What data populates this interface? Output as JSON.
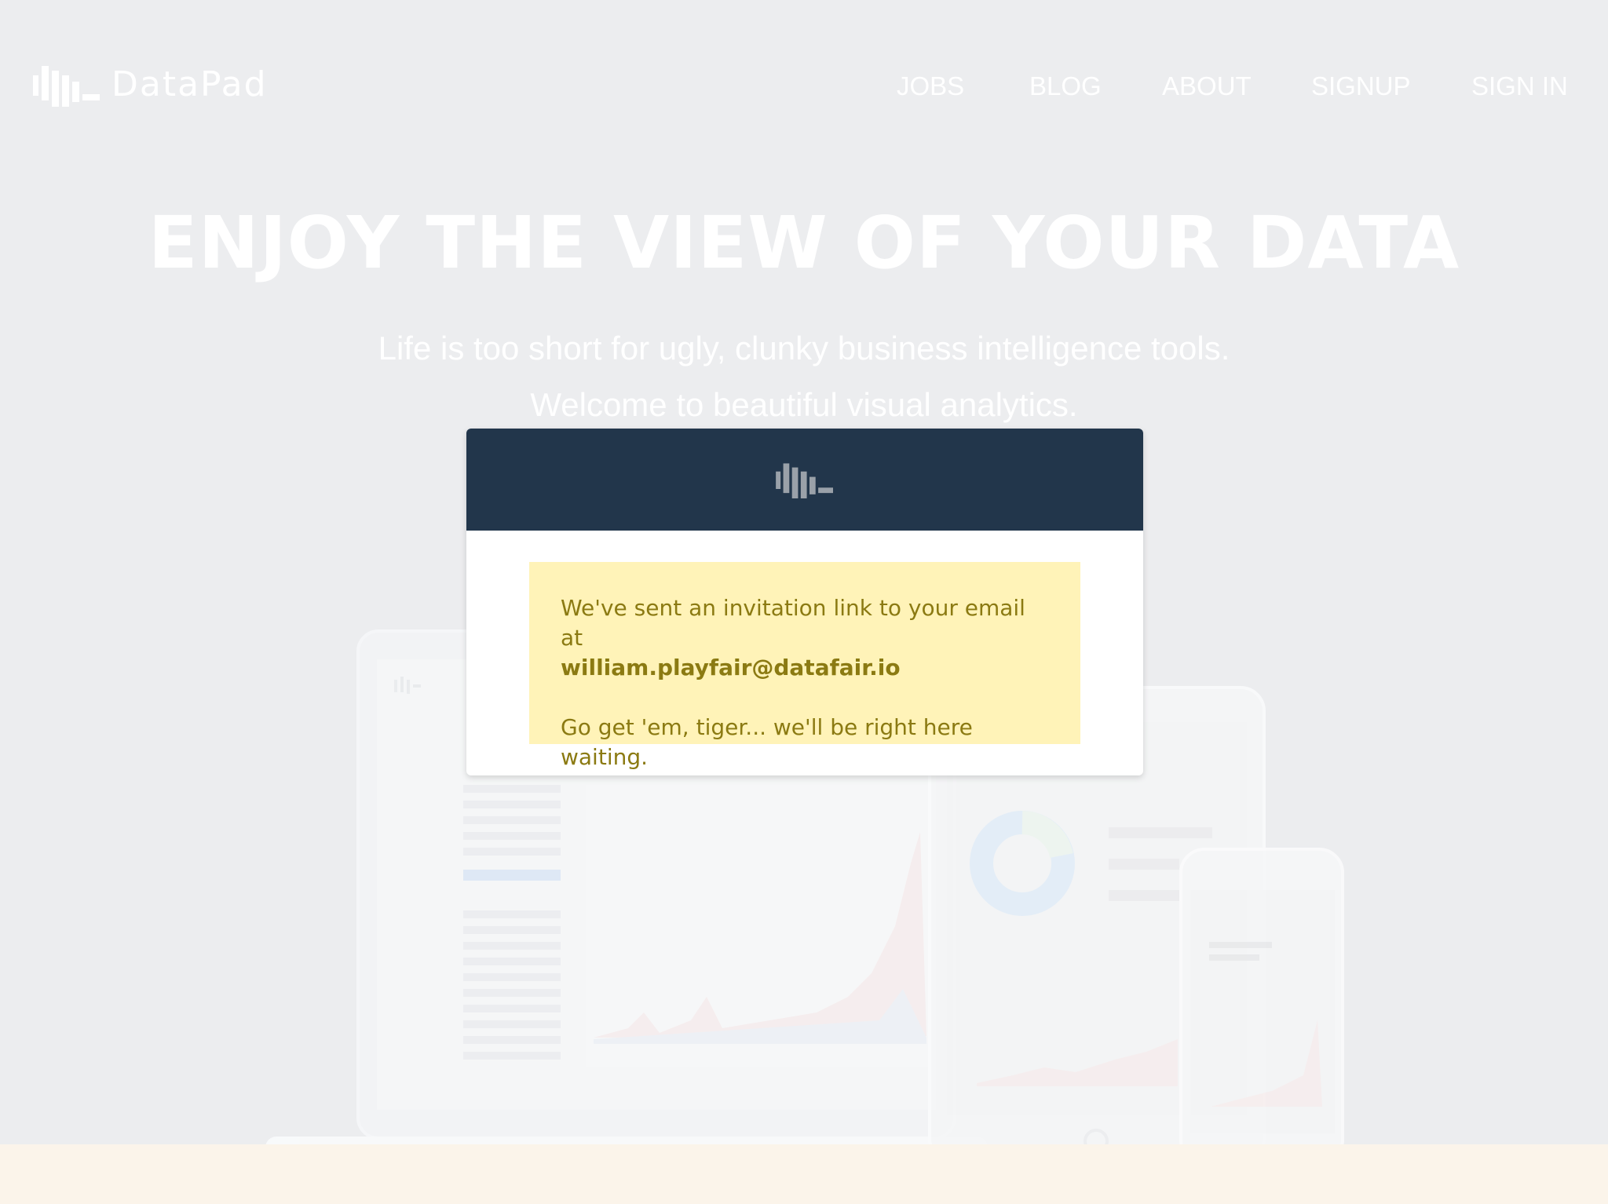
{
  "brand": {
    "name": "DataPad",
    "logo_icon": "datapad-bars-icon"
  },
  "nav": {
    "items": [
      {
        "label": "JOBS"
      },
      {
        "label": "BLOG"
      },
      {
        "label": "ABOUT"
      },
      {
        "label": "SIGNUP"
      },
      {
        "label": "SIGN IN"
      }
    ]
  },
  "hero": {
    "title": "ENJOY THE VIEW OF YOUR DATA",
    "subtitle_line1": "Life is too short for ugly, clunky business intelligence tools.",
    "subtitle_line2": "Welcome to beautiful visual analytics."
  },
  "modal": {
    "logo_icon": "datapad-bars-icon",
    "message_prefix": "We've sent an invitation link to your email at",
    "email": "william.playfair@datafair.io",
    "message_line2": "Go get 'em, tiger... we'll be right here waiting."
  },
  "colors": {
    "background": "#ecedef",
    "modal_header": "#22364b",
    "alert_background": "#fff3b8",
    "alert_text": "#8b7a12",
    "bottom_band": "#fbf4ea"
  }
}
